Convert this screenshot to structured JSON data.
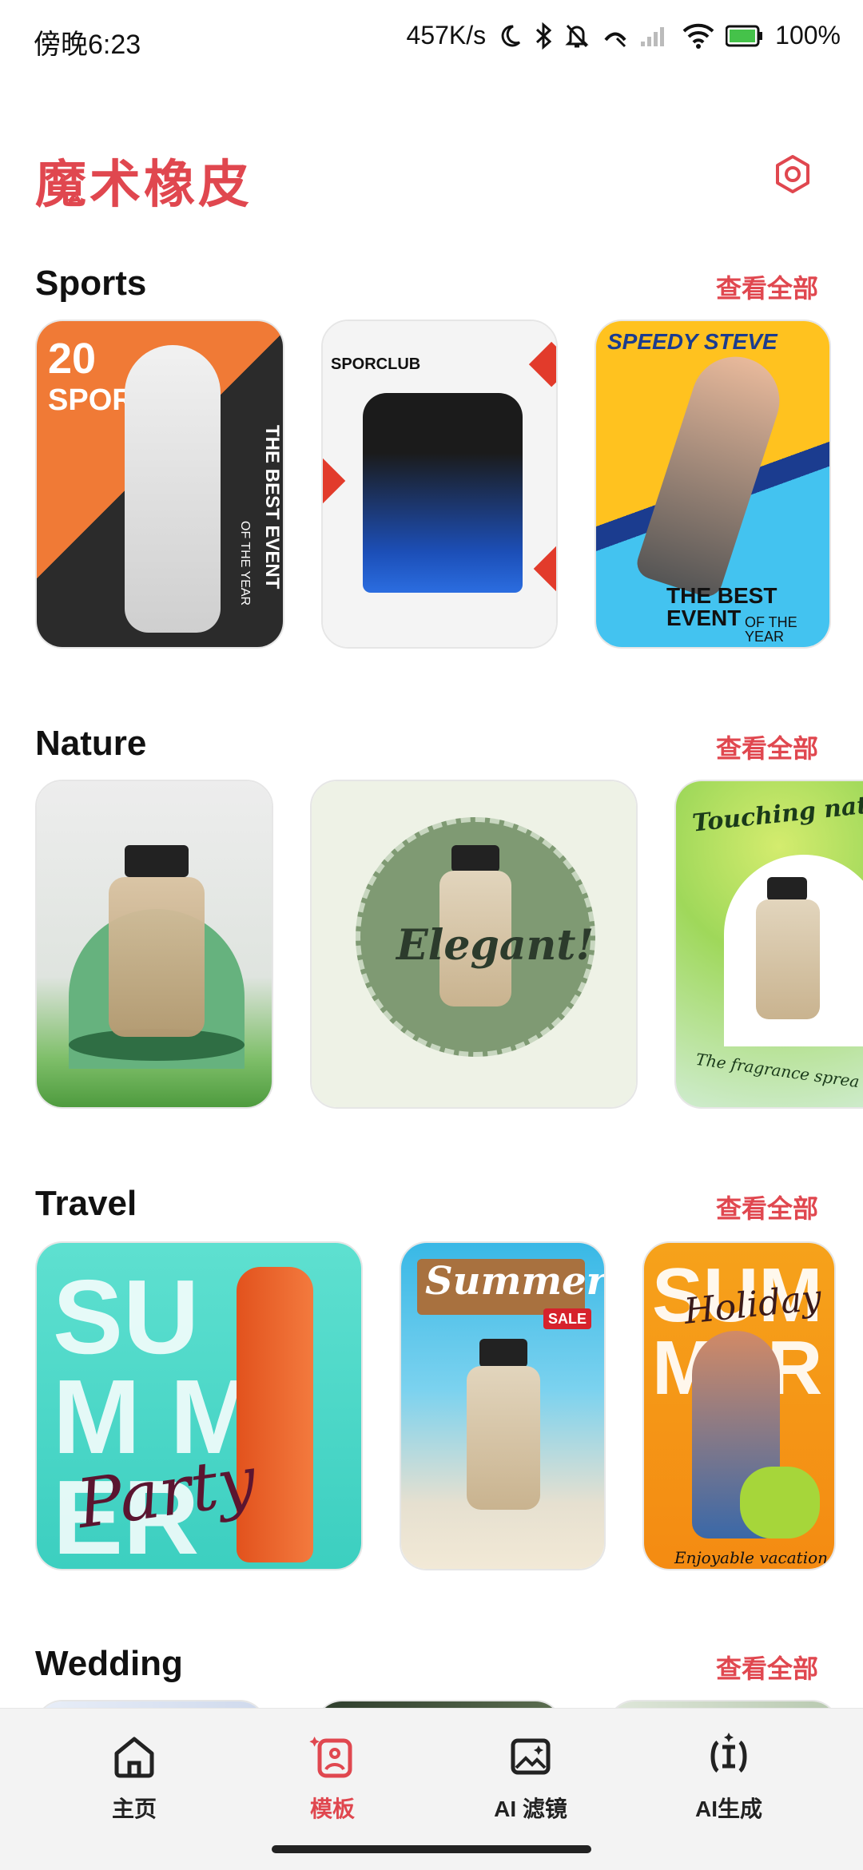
{
  "status": {
    "time": "傍晚6:23",
    "speed": "457K/s",
    "battery": "100%"
  },
  "header": {
    "title": "魔术橡皮"
  },
  "see_all": "查看全部",
  "sections": [
    {
      "title": "Sports"
    },
    {
      "title": "Nature"
    },
    {
      "title": "Travel"
    },
    {
      "title": "Wedding"
    }
  ],
  "cards": {
    "sports1": {
      "big": "20",
      "small": "SPORT",
      "side": "THE BEST EVENT",
      "side2": "OF THE YEAR"
    },
    "sports2": {
      "brand": "SPORCLUB"
    },
    "sports3": {
      "top": "SPEEDY STEVE",
      "main": "THE BEST EVENT",
      "sub": "OF THE YEAR"
    },
    "nature2": {
      "word": "Elegant!"
    },
    "nature3": {
      "top": "Touching natu",
      "bottom": "The fragrance sprea"
    },
    "travel1": {
      "big": "SUM MER",
      "script": "Party"
    },
    "travel2": {
      "script": "Summer",
      "sale": "SALE"
    },
    "travel3": {
      "big": "SUM MER",
      "script": "Holiday",
      "bottom": "Enjoyable vacation"
    }
  },
  "nav": [
    {
      "label": "主页",
      "icon": "home-icon"
    },
    {
      "label": "模板",
      "icon": "template-icon",
      "active": true
    },
    {
      "label": "AI 滤镜",
      "icon": "ai-filter-icon"
    },
    {
      "label": "AI生成",
      "icon": "ai-generate-icon"
    }
  ],
  "colors": {
    "accent": "#e0474f",
    "orange": "#f0793a",
    "teal": "#4fd6c7",
    "sage": "#7f9a73"
  }
}
